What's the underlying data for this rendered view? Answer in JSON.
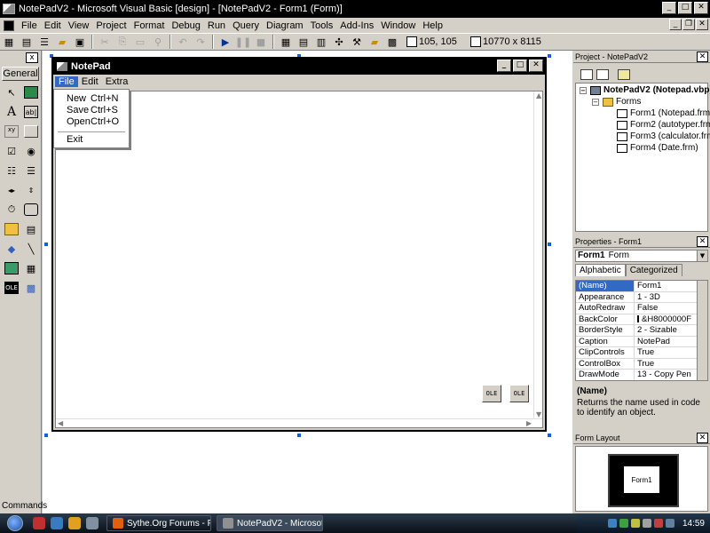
{
  "window": {
    "title": "NotePadV2 - Microsoft Visual Basic [design] - [NotePadV2 - Form1 (Form)]"
  },
  "menubar": [
    "File",
    "Edit",
    "View",
    "Project",
    "Format",
    "Debug",
    "Run",
    "Query",
    "Diagram",
    "Tools",
    "Add-Ins",
    "Window",
    "Help"
  ],
  "toolbar": {
    "position": "105, 105",
    "size": "10770 x 8115"
  },
  "toolbox": {
    "tab": "General",
    "close": "x"
  },
  "form": {
    "title": "NotePad",
    "menus": [
      "File",
      "Edit",
      "Extra"
    ],
    "file_menu": [
      {
        "label": "New",
        "shortcut": "Ctrl+N"
      },
      {
        "label": "Save",
        "shortcut": "Ctrl+S"
      },
      {
        "label": "Open",
        "shortcut": "Ctrl+O"
      },
      {
        "label": "Exit",
        "shortcut": ""
      }
    ],
    "control_icons": [
      "OLE",
      "OLE"
    ]
  },
  "project": {
    "title": "Project - NotePadV2",
    "root": "NotePadV2 (Notepad.vbp)",
    "folder": "Forms",
    "forms": [
      "Form1 (Notepad.frm)",
      "Form2 (autotyper.frm)",
      "Form3 (calculator.frm)",
      "Form4 (Date.frm)"
    ]
  },
  "properties": {
    "title": "Properties - Form1",
    "object_name": "Form1",
    "object_type": "Form",
    "tabs": [
      "Alphabetic",
      "Categorized"
    ],
    "rows": [
      {
        "name": "(Name)",
        "value": "Form1"
      },
      {
        "name": "Appearance",
        "value": "1 - 3D"
      },
      {
        "name": "AutoRedraw",
        "value": "False"
      },
      {
        "name": "BackColor",
        "value": "&H8000000F"
      },
      {
        "name": "BorderStyle",
        "value": "2 - Sizable"
      },
      {
        "name": "Caption",
        "value": "NotePad"
      },
      {
        "name": "ClipControls",
        "value": "True"
      },
      {
        "name": "ControlBox",
        "value": "True"
      },
      {
        "name": "DrawMode",
        "value": "13 - Copy Pen"
      }
    ],
    "desc_title": "(Name)",
    "desc_text": "Returns the name used in code to identify an object."
  },
  "form_layout": {
    "title": "Form Layout",
    "form_label": "Form1"
  },
  "commands": "Commands",
  "taskbar": {
    "tasks": [
      "Sythe.Org Forums - P...",
      "NotePadV2 - Microsoft..."
    ],
    "clock": "14:59"
  }
}
